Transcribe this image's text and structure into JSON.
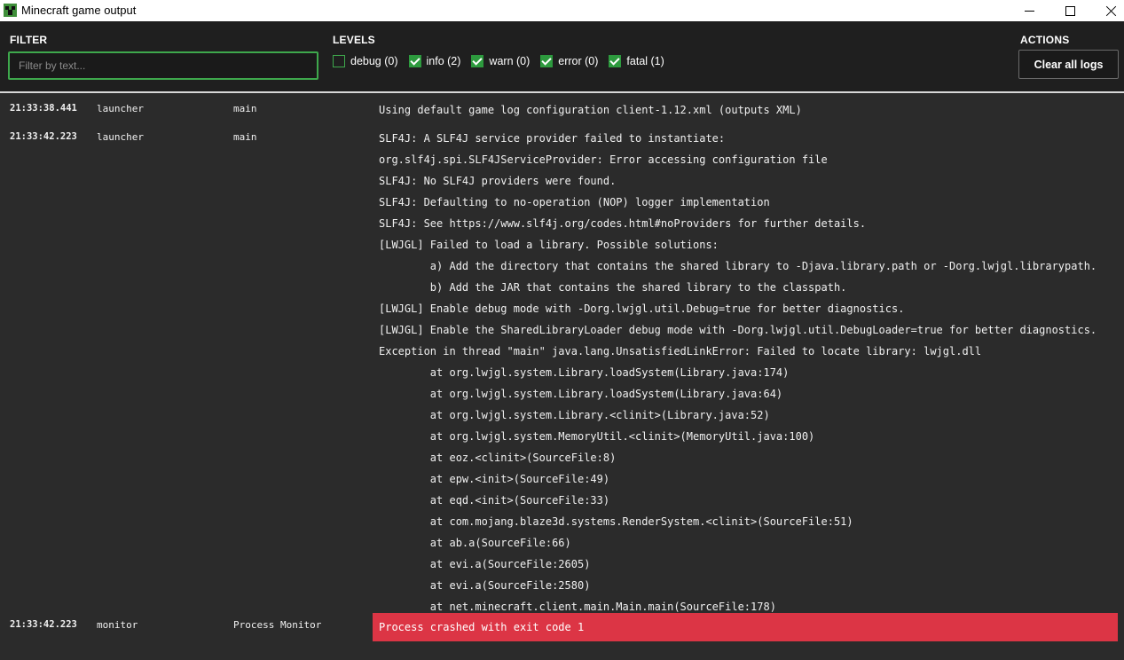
{
  "window": {
    "title": "Minecraft game output"
  },
  "toolbar": {
    "filter_title": "FILTER",
    "filter_placeholder": "Filter by text...",
    "filter_value": "",
    "levels_title": "LEVELS",
    "levels": [
      {
        "label": "debug (0)",
        "checked": false
      },
      {
        "label": "info (2)",
        "checked": true
      },
      {
        "label": "warn (0)",
        "checked": true
      },
      {
        "label": "error (0)",
        "checked": true
      },
      {
        "label": "fatal (1)",
        "checked": true
      }
    ],
    "actions_title": "ACTIONS",
    "clear_label": "Clear all logs"
  },
  "colors": {
    "accent_green": "#3ea84c",
    "checkbox_green": "#2d9a3e",
    "crash_red": "#dc3545",
    "background": "#2b2b2b",
    "toolbar_bg": "#1f1f1f"
  },
  "logs": [
    {
      "time": "21:33:38.441",
      "source": "launcher",
      "thread": "main",
      "lines": [
        "Using default game log configuration client-1.12.xml (outputs XML)"
      ]
    },
    {
      "time": "21:33:42.223",
      "source": "launcher",
      "thread": "main",
      "lines": [
        "SLF4J: A SLF4J service provider failed to instantiate:",
        "org.slf4j.spi.SLF4JServiceProvider: Error accessing configuration file",
        "SLF4J: No SLF4J providers were found.",
        "SLF4J: Defaulting to no-operation (NOP) logger implementation",
        "SLF4J: See https://www.slf4j.org/codes.html#noProviders for further details.",
        "[LWJGL] Failed to load a library. Possible solutions:",
        "        a) Add the directory that contains the shared library to -Djava.library.path or -Dorg.lwjgl.librarypath.",
        "        b) Add the JAR that contains the shared library to the classpath.",
        "[LWJGL] Enable debug mode with -Dorg.lwjgl.util.Debug=true for better diagnostics.",
        "[LWJGL] Enable the SharedLibraryLoader debug mode with -Dorg.lwjgl.util.DebugLoader=true for better diagnostics.",
        "Exception in thread \"main\" java.lang.UnsatisfiedLinkError: Failed to locate library: lwjgl.dll",
        "        at org.lwjgl.system.Library.loadSystem(Library.java:174)",
        "        at org.lwjgl.system.Library.loadSystem(Library.java:64)",
        "        at org.lwjgl.system.Library.<clinit>(Library.java:52)",
        "        at org.lwjgl.system.MemoryUtil.<clinit>(MemoryUtil.java:100)",
        "        at eoz.<clinit>(SourceFile:8)",
        "        at epw.<init>(SourceFile:49)",
        "        at eqd.<init>(SourceFile:33)",
        "        at com.mojang.blaze3d.systems.RenderSystem.<clinit>(SourceFile:51)",
        "        at ab.a(SourceFile:66)",
        "        at evi.a(SourceFile:2605)",
        "        at evi.a(SourceFile:2580)",
        "        at net.minecraft.client.main.Main.main(SourceFile:178)"
      ]
    },
    {
      "time": "21:33:42.223",
      "source": "monitor",
      "thread": "Process Monitor",
      "lines": [
        "Process crashed with exit code 1"
      ],
      "fatal": true
    }
  ]
}
